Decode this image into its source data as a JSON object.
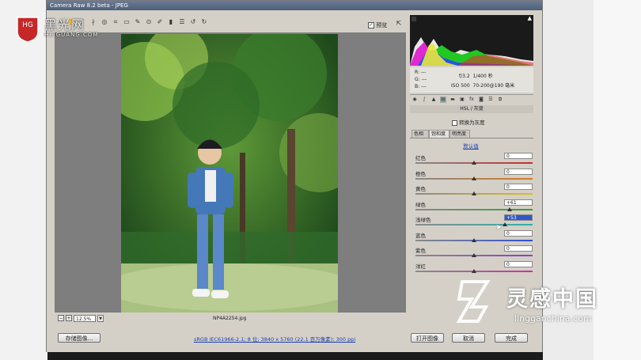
{
  "window": {
    "title": "Camera Raw 8.2 beta - JPEG"
  },
  "toolbar": {
    "preview_label": "预览"
  },
  "image": {
    "filename": "NP4A2254.jpg",
    "zoom": "12.5%"
  },
  "footer": {
    "save_label": "存储图像...",
    "info_link": "sRGB IEC61966-2.1; 8 位; 3840 x 5760 (22.1 百万像素); 300 ppi",
    "open_label": "打开图像",
    "cancel_label": "取消",
    "done_label": "完成"
  },
  "camera_info": {
    "r_label": "R:",
    "r_val": "---",
    "g_label": "G:",
    "g_val": "---",
    "b_label": "B:",
    "b_val": "---",
    "aperture": "f/3.2",
    "shutter": "1/400 秒",
    "iso": "ISO 500",
    "lens": "70-200@190 毫米"
  },
  "panel": {
    "section_title": "HSL / 灰度",
    "grayscale_label": "转换为灰度",
    "tabs": [
      "色相",
      "饱和度",
      "明亮度"
    ],
    "active_tab": 1,
    "default_link": "默认值",
    "sliders": [
      {
        "label": "红色",
        "value": "0",
        "pos": 0.5,
        "colors": [
          "#8a8a8a",
          "#c23030"
        ]
      },
      {
        "label": "橙色",
        "value": "0",
        "pos": 0.5,
        "colors": [
          "#8a8a8a",
          "#d87a20"
        ]
      },
      {
        "label": "黄色",
        "value": "0",
        "pos": 0.5,
        "colors": [
          "#8a8a8a",
          "#d8c020"
        ]
      },
      {
        "label": "绿色",
        "value": "+61",
        "pos": 0.805,
        "colors": [
          "#8a8a8a",
          "#3aa030"
        ]
      },
      {
        "label": "浅绿色",
        "value": "+53",
        "pos": 0.765,
        "colors": [
          "#8a8a8a",
          "#30b0a8"
        ],
        "highlight": true
      },
      {
        "label": "蓝色",
        "value": "0",
        "pos": 0.5,
        "colors": [
          "#8a8a8a",
          "#3050d0"
        ]
      },
      {
        "label": "紫色",
        "value": "0",
        "pos": 0.5,
        "colors": [
          "#8a8a8a",
          "#8a40c8"
        ]
      },
      {
        "label": "洋红",
        "value": "0",
        "pos": 0.5,
        "colors": [
          "#8a8a8a",
          "#d030a0"
        ]
      }
    ]
  },
  "watermarks": {
    "hg_mark": "HG",
    "site_name": "黑光网",
    "site_url": "HEIGUANG.COM",
    "brand_name": "灵感中国",
    "brand_url": "lingganchina.com"
  }
}
